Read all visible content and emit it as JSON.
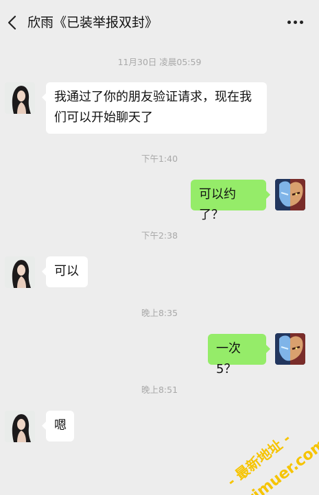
{
  "header": {
    "title": "欣雨《已装举报双封》",
    "back_icon": "chevron-left-icon",
    "more_icon": "more-dots-icon"
  },
  "messages": [
    {
      "type": "time",
      "text": "11月30日 凌晨05:59"
    },
    {
      "type": "msg",
      "side": "left",
      "avatar": "avatar-contact",
      "text": "我通过了你的朋友验证请求，现在我们可以开始聊天了"
    },
    {
      "type": "time",
      "text": "下午1:40"
    },
    {
      "type": "msg",
      "side": "right",
      "avatar": "avatar-self",
      "text": "可以约了？"
    },
    {
      "type": "time",
      "text": "下午2:38"
    },
    {
      "type": "msg",
      "side": "left",
      "avatar": "avatar-contact",
      "text": "可以"
    },
    {
      "type": "time",
      "text": "晚上8:35"
    },
    {
      "type": "msg",
      "side": "right",
      "avatar": "avatar-self",
      "text": "一次 5？"
    },
    {
      "type": "time",
      "text": "晚上8:51"
    },
    {
      "type": "msg",
      "side": "left",
      "avatar": "avatar-contact",
      "text": "嗯"
    }
  ],
  "watermark": {
    "line1": "- 最新地址 -",
    "line2": "rimuer.com"
  },
  "colors": {
    "background": "#ededed",
    "bubble_incoming": "#ffffff",
    "bubble_outgoing": "#95ec69",
    "watermark": "#f6c400"
  }
}
